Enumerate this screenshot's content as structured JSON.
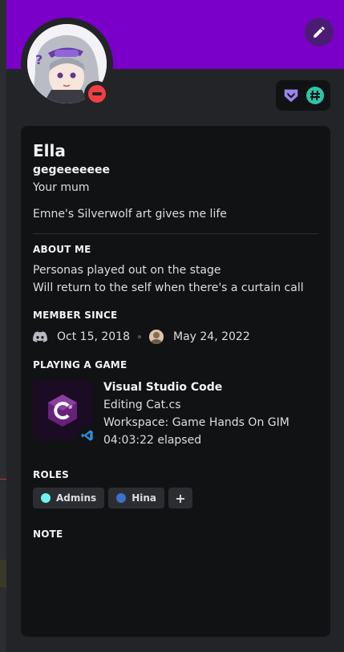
{
  "profile": {
    "display_name": "Ella",
    "username": "gegeeeeeee",
    "pronouns": "Your mum",
    "custom_status": "Emne's Silverwolf art gives me life",
    "banner_color": "#7a00c9",
    "status": "do-not-disturb"
  },
  "about": {
    "heading": "ABOUT ME",
    "line1": "Personas played out on the stage",
    "line2": "Will return to the self when there's a curtain call"
  },
  "member_since": {
    "heading": "MEMBER SINCE",
    "discord_date": "Oct 15, 2018",
    "server_date": "May 24, 2022"
  },
  "activity": {
    "heading": "PLAYING A GAME",
    "title": "Visual Studio Code",
    "details": "Editing Cat.cs",
    "state": "Workspace: Game Hands On GIM",
    "elapsed": "04:03:22 elapsed"
  },
  "roles": {
    "heading": "ROLES",
    "items": [
      {
        "label": "Admins",
        "color": "#6ff3f2"
      },
      {
        "label": "Hina",
        "color": "#3a72c8"
      }
    ],
    "add_label": "+"
  },
  "note": {
    "heading": "NOTE"
  },
  "icons": {
    "edit": "pencil-icon",
    "badges": [
      "hypesquad-balance-icon",
      "hashtag-icon"
    ],
    "member_since": "discord-logo-icon",
    "game": "csharp-icon",
    "game_small": "vscode-icon"
  }
}
